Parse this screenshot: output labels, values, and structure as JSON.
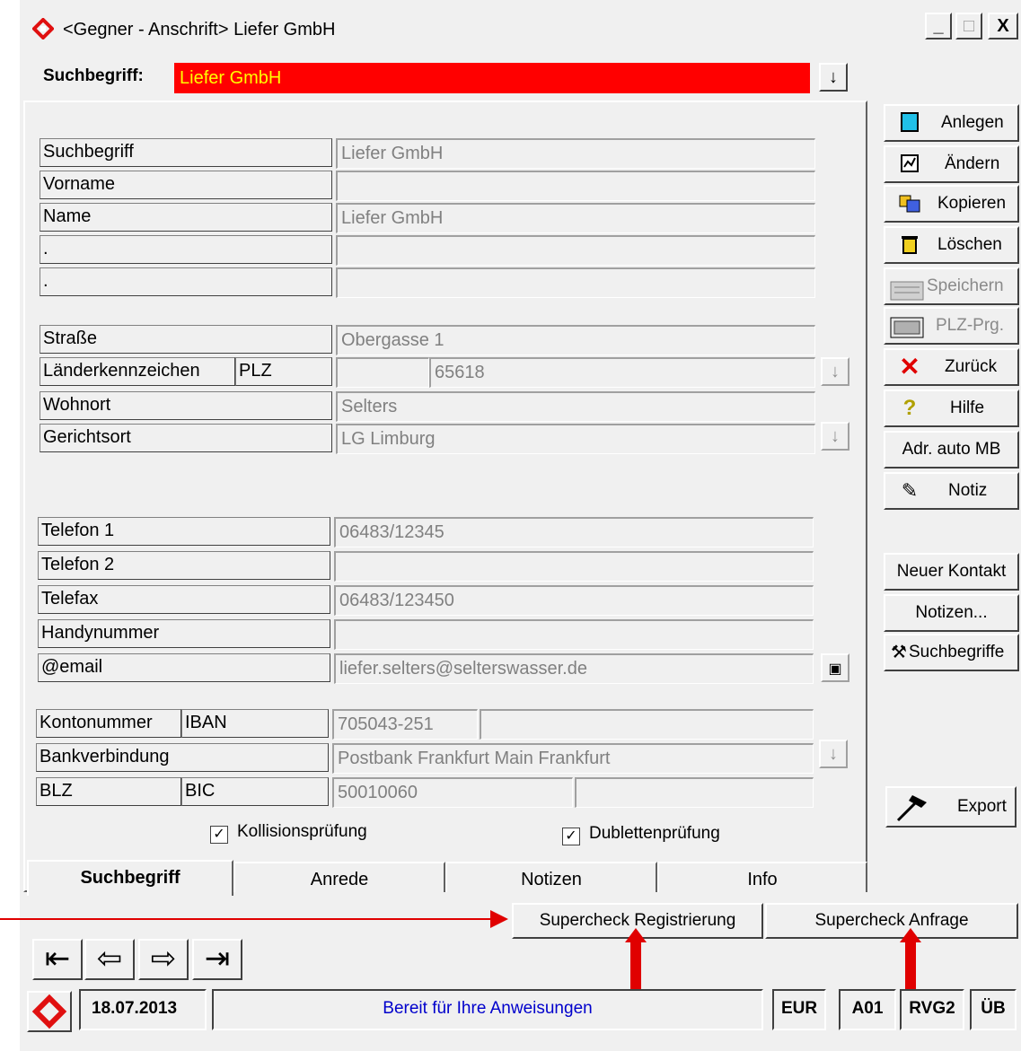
{
  "window": {
    "title": "<Gegner - Anschrift> Liefer GmbH",
    "min_label": "_",
    "max_label": "□",
    "close_label": "X"
  },
  "search": {
    "label": "Suchbegriff:",
    "value": "Liefer GmbH",
    "bg_color": "#ff0000",
    "text_color": "#ffff00"
  },
  "fields": {
    "suchbegriff": {
      "label": "Suchbegriff",
      "value": "Liefer GmbH"
    },
    "vorname": {
      "label": "Vorname",
      "value": ""
    },
    "name": {
      "label": "Name",
      "value": "Liefer GmbH"
    },
    "extra1": {
      "label": ".",
      "value": ""
    },
    "extra2": {
      "label": ".",
      "value": ""
    },
    "strasse": {
      "label": "Straße",
      "value": "Obergasse 1"
    },
    "laenderkennzeichen": {
      "label": "Länderkennzeichen",
      "value": ""
    },
    "plz": {
      "label": "PLZ",
      "value": "65618"
    },
    "wohnort": {
      "label": "Wohnort",
      "value": "Selters"
    },
    "gerichtsort": {
      "label": "Gerichtsort",
      "value": "LG Limburg"
    },
    "telefon1": {
      "label": "Telefon 1",
      "value": "06483/12345"
    },
    "telefon2": {
      "label": "Telefon 2",
      "value": ""
    },
    "telefax": {
      "label": "Telefax",
      "value": "06483/123450"
    },
    "handy": {
      "label": "Handynummer",
      "value": ""
    },
    "email": {
      "label": "@email",
      "value": "liefer.selters@selterswasser.de"
    },
    "kontonummer": {
      "label": "Kontonummer",
      "value": "705043-251"
    },
    "iban": {
      "label": "IBAN",
      "value": ""
    },
    "bankverbindung": {
      "label": "Bankverbindung",
      "value": "Postbank Frankfurt Main Frankfurt"
    },
    "blz": {
      "label": "BLZ",
      "value": "50010060"
    },
    "bic": {
      "label": "BIC",
      "value": ""
    }
  },
  "checks": {
    "kollision": {
      "label": "Kollisionsprüfung",
      "checked": true
    },
    "dubletten": {
      "label": "Dublettenprüfung",
      "checked": true
    }
  },
  "tabs": [
    {
      "label": "Suchbegriff",
      "active": true
    },
    {
      "label": "Anrede",
      "active": false
    },
    {
      "label": "Notizen",
      "active": false
    },
    {
      "label": "Info",
      "active": false
    }
  ],
  "actions": {
    "anlegen": {
      "label": "Anlegen",
      "icon": "new-document-icon"
    },
    "aendern": {
      "label": "Ändern",
      "icon": "edit-document-icon"
    },
    "kopieren": {
      "label": "Kopieren",
      "icon": "copy-icon"
    },
    "loeschen": {
      "label": "Löschen",
      "icon": "trash-icon"
    },
    "speichern": {
      "label": "Speichern",
      "icon": "save-icon",
      "disabled": true
    },
    "plz": {
      "label": "PLZ-Prg.",
      "icon": "keyboard-icon",
      "disabled": true
    },
    "zurueck": {
      "label": "Zurück",
      "icon": "red-x-icon"
    },
    "hilfe": {
      "label": "Hilfe",
      "icon": "question-icon"
    },
    "adr_auto": {
      "label": "Adr. auto MB"
    },
    "notiz": {
      "label": "Notiz",
      "icon": "note-icon"
    },
    "neuer_kontakt": {
      "label": "Neuer Kontakt"
    },
    "notizen": {
      "label": "Notizen..."
    },
    "suchbegriffe": {
      "label": "Suchbegriffe",
      "icon": "hammer-icon"
    },
    "export": {
      "label": "Export",
      "icon": "hammer-icon"
    }
  },
  "supercheck": {
    "registrierung": "Supercheck Registrierung",
    "anfrage": "Supercheck Anfrage"
  },
  "status": {
    "date": "18.07.2013",
    "message": "Bereit für Ihre Anweisungen",
    "currency": "EUR",
    "code": "A01",
    "rvg": "RVG2",
    "ub": "ÜB"
  },
  "colors": {
    "accent_red": "#e00000",
    "status_text": "#0000cc"
  }
}
